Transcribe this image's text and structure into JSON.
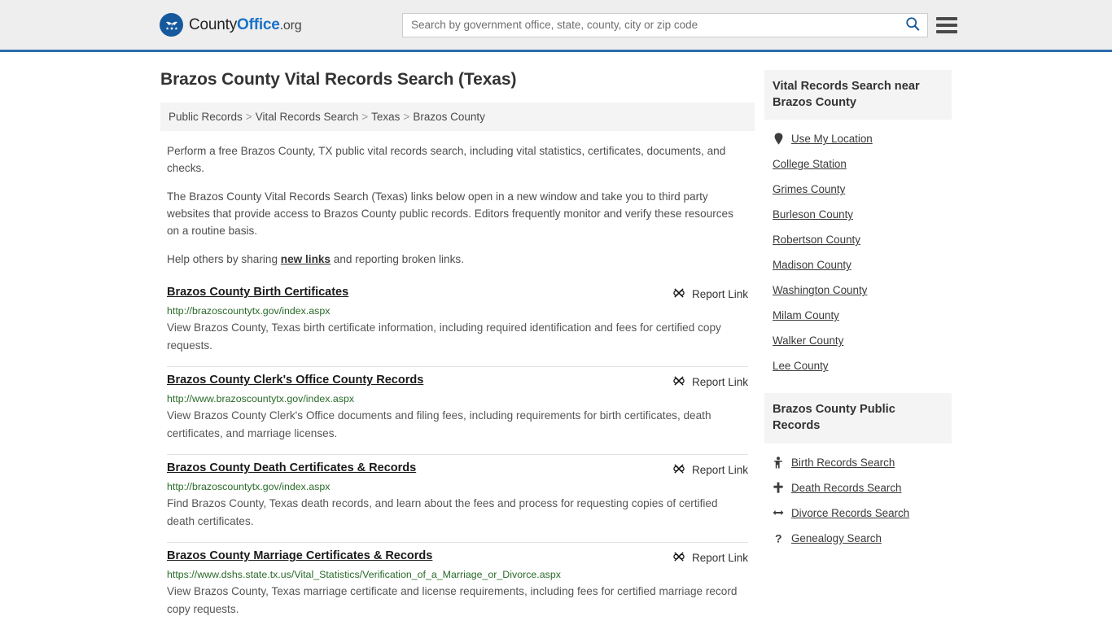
{
  "header": {
    "logo": {
      "part1": "County",
      "part2": "Office",
      "part3": ".org",
      "icon": "eagle-seal-icon"
    },
    "search": {
      "placeholder": "Search by government office, state, county, city or zip code",
      "value": "",
      "icon": "search-icon"
    },
    "menu_icon": "hamburger-menu-icon",
    "accent_color": "#2b6cb0"
  },
  "page": {
    "title": "Brazos County Vital Records Search (Texas)"
  },
  "breadcrumb": {
    "separator": ">",
    "items": [
      {
        "label": "Public Records"
      },
      {
        "label": "Vital Records Search"
      },
      {
        "label": "Texas"
      },
      {
        "label": "Brazos County"
      }
    ]
  },
  "intro": {
    "p1": "Perform a free Brazos County, TX public vital records search, including vital statistics, certificates, documents, and checks.",
    "p2": "The Brazos County Vital Records Search (Texas) links below open in a new window and take you to third party websites that provide access to Brazos County public records. Editors frequently monitor and verify these resources on a routine basis.",
    "p3_before": "Help others by sharing ",
    "p3_link": "new links",
    "p3_after": " and reporting broken links."
  },
  "results": {
    "report_label": "Report Link",
    "report_icon": "broken-link-icon",
    "items": [
      {
        "title": "Brazos County Birth Certificates",
        "url": "http://brazoscountytx.gov/index.aspx",
        "desc": "View Brazos County, Texas birth certificate information, including required identification and fees for certified copy requests."
      },
      {
        "title": "Brazos County Clerk's Office County Records",
        "url": "http://www.brazoscountytx.gov/index.aspx",
        "desc": "View Brazos County Clerk's Office documents and filing fees, including requirements for birth certificates, death certificates, and marriage licenses."
      },
      {
        "title": "Brazos County Death Certificates & Records",
        "url": "http://brazoscountytx.gov/index.aspx",
        "desc": "Find Brazos County, Texas death records, and learn about the fees and process for requesting copies of certified death certificates."
      },
      {
        "title": "Brazos County Marriage Certificates & Records",
        "url": "https://www.dshs.state.tx.us/Vital_Statistics/Verification_of_a_Marriage_or_Divorce.aspx",
        "desc": "View Brazos County, Texas marriage certificate and license requirements, including fees for certified marriage record copy requests."
      }
    ]
  },
  "sidebar": {
    "nearby": {
      "heading": "Vital Records Search near Brazos County",
      "items": [
        {
          "label": "Use My Location",
          "icon": "map-pin-icon"
        },
        {
          "label": "College Station",
          "icon": ""
        },
        {
          "label": "Grimes County",
          "icon": ""
        },
        {
          "label": "Burleson County",
          "icon": ""
        },
        {
          "label": "Robertson County",
          "icon": ""
        },
        {
          "label": "Madison County",
          "icon": ""
        },
        {
          "label": "Washington County",
          "icon": ""
        },
        {
          "label": "Milam County",
          "icon": ""
        },
        {
          "label": "Walker County",
          "icon": ""
        },
        {
          "label": "Lee County",
          "icon": ""
        }
      ]
    },
    "public_records": {
      "heading": "Brazos County Public Records",
      "items": [
        {
          "label": "Birth Records Search",
          "icon": "baby-icon"
        },
        {
          "label": "Death Records Search",
          "icon": "cross-icon"
        },
        {
          "label": "Divorce Records Search",
          "icon": "left-right-arrow-icon"
        },
        {
          "label": "Genealogy Search",
          "icon": "question-mark-icon"
        }
      ]
    }
  }
}
